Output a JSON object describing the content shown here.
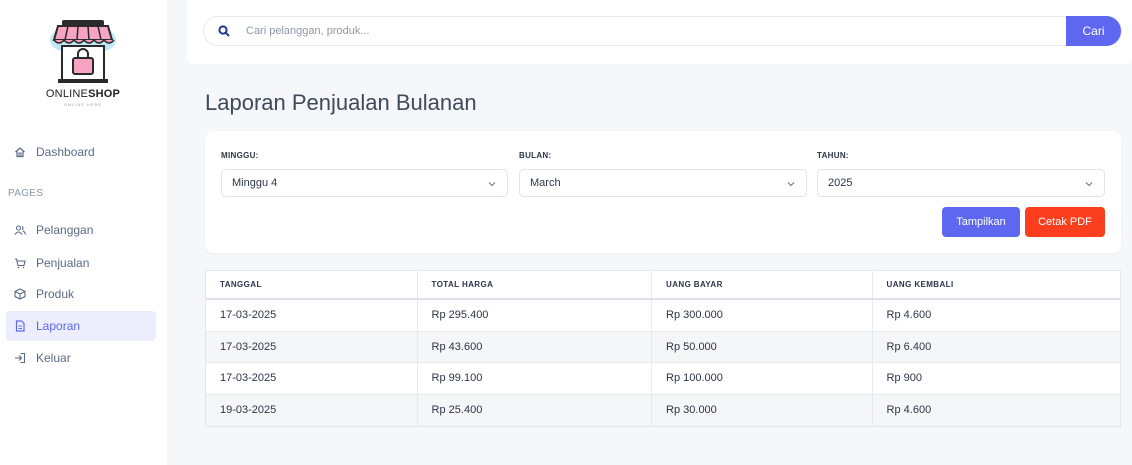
{
  "brand": {
    "name_light": "ONLINE",
    "name_bold": "SHOP",
    "tagline": "ONLINE HERE"
  },
  "sidebar": {
    "dashboard": "Dashboard",
    "section_heading": "PAGES",
    "items": [
      {
        "label": "Pelanggan",
        "icon": "users-icon"
      },
      {
        "label": "Penjualan",
        "icon": "cart-icon"
      },
      {
        "label": "Produk",
        "icon": "box-icon"
      },
      {
        "label": "Laporan",
        "icon": "file-icon",
        "active": true
      },
      {
        "label": "Keluar",
        "icon": "logout-icon"
      }
    ]
  },
  "search": {
    "placeholder": "Cari pelanggan, produk...",
    "button": "Cari"
  },
  "page": {
    "title": "Laporan Penjualan Bulanan"
  },
  "filters": {
    "week": {
      "label": "MINGGU:",
      "value": "Minggu 4"
    },
    "month": {
      "label": "BULAN:",
      "value": "March"
    },
    "year": {
      "label": "TAHUN:",
      "value": "2025"
    },
    "show_button": "Tampilkan",
    "pdf_button": "Cetak PDF"
  },
  "table": {
    "headers": [
      "TANGGAL",
      "TOTAL HARGA",
      "UANG BAYAR",
      "UANG KEMBALI"
    ],
    "rows": [
      [
        "17-03-2025",
        "Rp 295.400",
        "Rp 300.000",
        "Rp 4.600"
      ],
      [
        "17-03-2025",
        "Rp 43.600",
        "Rp 50.000",
        "Rp 6.400"
      ],
      [
        "17-03-2025",
        "Rp 99.100",
        "Rp 100.000",
        "Rp 900"
      ],
      [
        "19-03-2025",
        "Rp 25.400",
        "Rp 30.000",
        "Rp 4.600"
      ]
    ]
  },
  "colors": {
    "accent": "#5d67f0",
    "danger": "#fa3e1e",
    "active_bg": "#eceefe"
  }
}
